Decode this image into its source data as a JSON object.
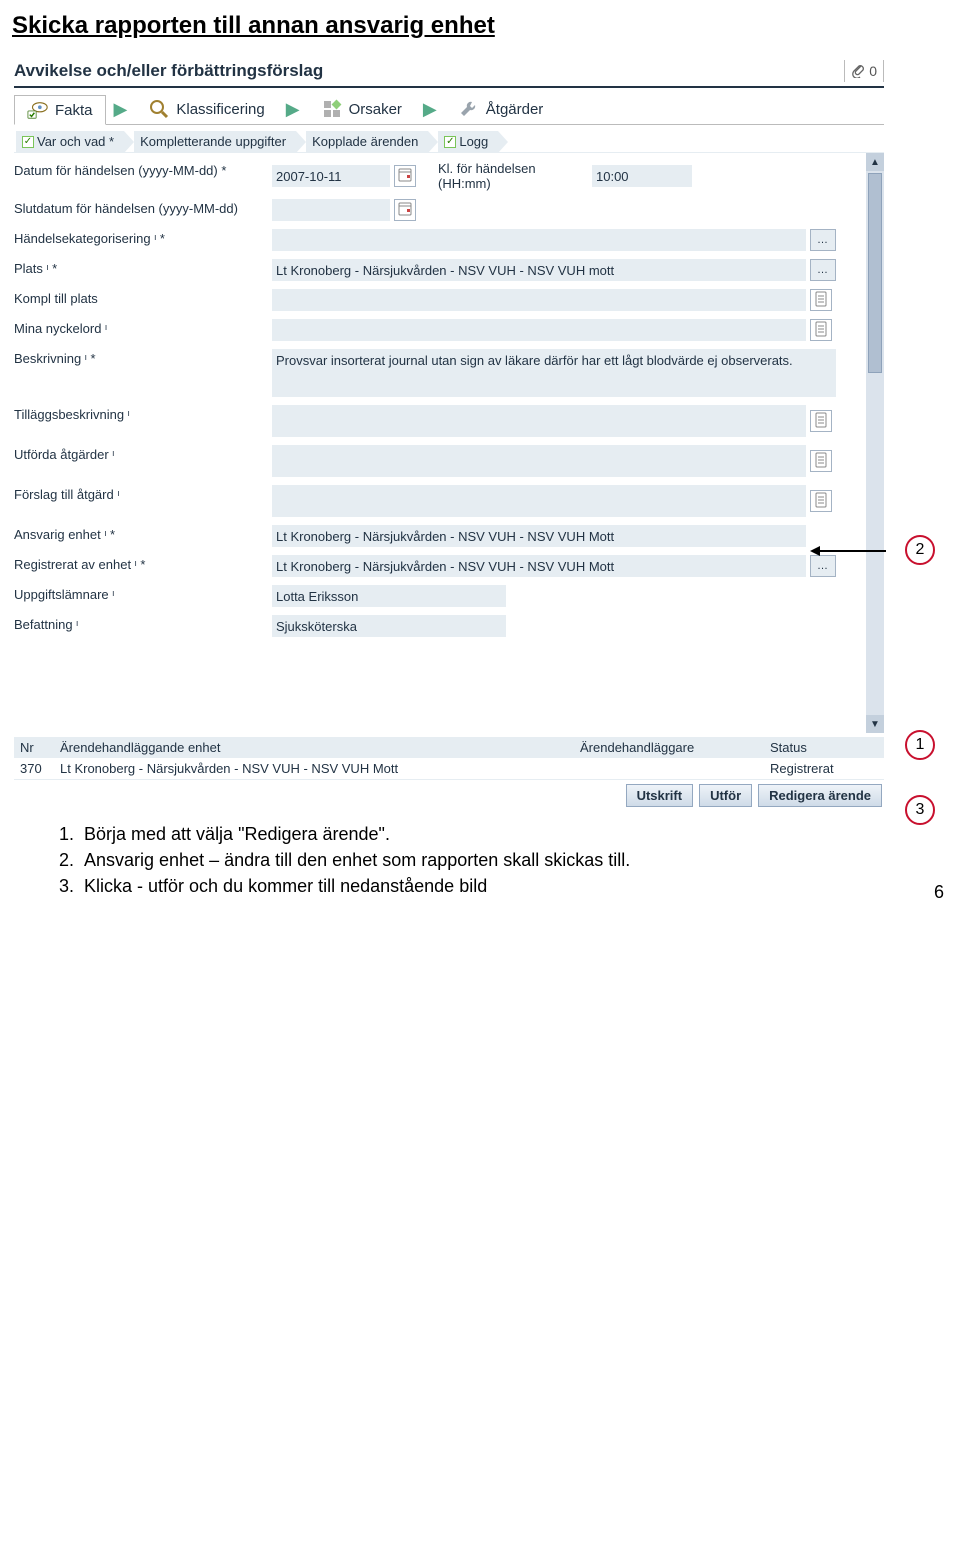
{
  "page": {
    "title": "Skicka rapporten till annan ansvarig enhet",
    "page_number": "6"
  },
  "header": {
    "title": "Avvikelse och/eller förbättringsförslag",
    "attachment_count": "0"
  },
  "main_tabs": [
    {
      "label": "Fakta",
      "icon": "eye-check",
      "active": true
    },
    {
      "label": "Klassificering",
      "icon": "magnifier"
    },
    {
      "label": "Orsaker",
      "icon": "squares"
    },
    {
      "label": "Åtgärder",
      "icon": "wrench"
    }
  ],
  "sub_tabs": [
    {
      "label": "Var och vad *",
      "check": true
    },
    {
      "label": "Kompletterande uppgifter",
      "check": false
    },
    {
      "label": "Kopplade ärenden",
      "check": false
    },
    {
      "label": "Logg",
      "check": true
    }
  ],
  "fields": {
    "datum_label": "Datum för händelsen (yyyy-MM-dd) *",
    "datum_value": "2007-10-11",
    "kl_label": "Kl. för händelsen (HH:mm)",
    "kl_value": "10:00",
    "slutdatum_label": "Slutdatum för händelsen (yyyy-MM-dd)",
    "slutdatum_value": "",
    "hkat_label": "Händelsekategorisering ᶦ *",
    "hkat_value": "",
    "plats_label": "Plats ᶦ *",
    "plats_value": "Lt Kronoberg - Närsjukvården - NSV VUH - NSV VUH mott",
    "kompl_label": "Kompl till plats",
    "kompl_value": "",
    "nyckel_label": "Mina nyckelord ᶦ",
    "nyckel_value": "",
    "beskr_label": "Beskrivning ᶦ *",
    "beskr_value": "Provsvar insorterat journal utan sign av läkare därför har ett lågt blodvärde ej observerats.",
    "tillagg_label": "Tilläggsbeskrivning ᶦ",
    "tillagg_value": "",
    "atgarder_label": "Utförda åtgärder ᶦ",
    "atgarder_value": "",
    "forslag_label": "Förslag till åtgärd ᶦ",
    "forslag_value": "",
    "ansvarig_label": "Ansvarig enhet ᶦ *",
    "ansvarig_value": "Lt Kronoberg - Närsjukvården - NSV VUH - NSV VUH Mott",
    "regenhet_label": "Registrerat av enhet ᶦ *",
    "regenhet_value": "Lt Kronoberg - Närsjukvården - NSV VUH - NSV VUH Mott",
    "uppgifts_label": "Uppgiftslämnare ᶦ",
    "uppgifts_value": "Lotta Eriksson",
    "befatt_label": "Befattning ᶦ",
    "befatt_value": "Sjuksköterska"
  },
  "grid": {
    "headers": {
      "nr": "Nr",
      "enhet": "Ärendehandläggande enhet",
      "handl": "Ärendehandläggare",
      "status": "Status"
    },
    "row": {
      "nr": "370",
      "enhet": "Lt Kronoberg - Närsjukvården - NSV VUH - NSV VUH Mott",
      "handl": "",
      "status": "Registrerat"
    }
  },
  "footer_buttons": {
    "utskrift": "Utskrift",
    "utfor": "Utför",
    "redigera": "Redigera ärende"
  },
  "callouts": {
    "c1": "1",
    "c2": "2",
    "c3": "3"
  },
  "instructions": {
    "i1_num": "1.",
    "i1_text": "Börja med att välja \"Redigera ärende\".",
    "i2_num": "2.",
    "i2_text": "Ansvarig enhet – ändra till den enhet som rapporten skall skickas till.",
    "i3_num": "3.",
    "i3_text": "Klicka - utför och du kommer till nedanstående bild"
  }
}
